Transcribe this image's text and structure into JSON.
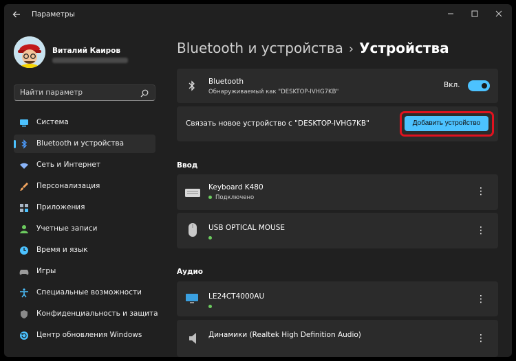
{
  "window": {
    "title": "Параметры",
    "back_icon": "back-arrow-icon",
    "controls": [
      "minimize-icon",
      "maximize-icon",
      "close-icon"
    ]
  },
  "user": {
    "name": "Виталий Каиров"
  },
  "search": {
    "placeholder": "Найти параметр"
  },
  "sidebar": {
    "items": [
      {
        "label": "Система",
        "icon": "monitor-icon",
        "color": "#4cc2ff"
      },
      {
        "label": "Bluetooth и устройства",
        "icon": "bluetooth-icon",
        "color": "#4c9cff",
        "active": true
      },
      {
        "label": "Сеть и Интернет",
        "icon": "wifi-icon",
        "color": "#8ab4f8"
      },
      {
        "label": "Персонализация",
        "icon": "brush-icon",
        "color": "#f0a35e"
      },
      {
        "label": "Приложения",
        "icon": "apps-icon",
        "color": "#a9b7c6"
      },
      {
        "label": "Учетные записи",
        "icon": "person-icon",
        "color": "#6ccb5f"
      },
      {
        "label": "Время и язык",
        "icon": "globe-clock-icon",
        "color": "#4cc2ff"
      },
      {
        "label": "Игры",
        "icon": "gamepad-icon",
        "color": "#9a9a9a"
      },
      {
        "label": "Специальные возможности",
        "icon": "accessibility-icon",
        "color": "#4cc2ff"
      },
      {
        "label": "Конфиденциальность и защита",
        "icon": "shield-icon",
        "color": "#8a8a8a"
      },
      {
        "label": "Центр обновления Windows",
        "icon": "update-icon",
        "color": "#4cc2ff"
      }
    ]
  },
  "breadcrumb": {
    "parent": "Bluetooth и устройства",
    "separator": "›",
    "current": "Устройства"
  },
  "bluetooth": {
    "title": "Bluetooth",
    "subtitle": "Обнаруживаемый как \"DESKTOP-IVHG7KB\"",
    "toggle_label": "Вкл.",
    "enabled": true
  },
  "pair": {
    "text": "Связать новое устройство с \"DESKTOP-IVHG7KB\"",
    "button_label": "Добавить устройство"
  },
  "sections": {
    "input": "Ввод",
    "audio": "Аудио"
  },
  "input_devices": [
    {
      "name": "Keyboard K480",
      "status": "Подключено",
      "icon": "keyboard-icon"
    },
    {
      "name": "USB OPTICAL MOUSE",
      "status": "",
      "icon": "mouse-icon"
    }
  ],
  "audio_devices": [
    {
      "name": "LE24CT4000AU",
      "status": "",
      "icon": "monitor-icon"
    },
    {
      "name": "Динамики (Realtek High Definition Audio)",
      "status": "",
      "icon": "speaker-icon"
    }
  ],
  "colors": {
    "accent": "#4cc2ff",
    "highlight": "#e0121f",
    "background": "#202020",
    "card": "#2b2b2b",
    "connected": "#6ccb5f"
  }
}
